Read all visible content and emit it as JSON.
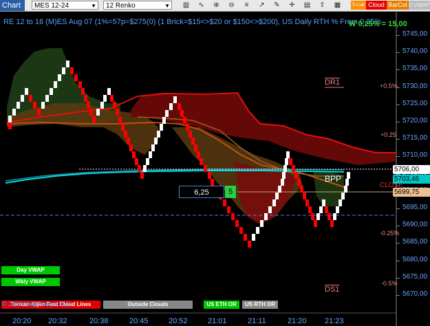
{
  "toolbar": {
    "chart_label": "Chart",
    "instrument": "MES 12-24",
    "bar_type": "12 Renko",
    "tags": [
      "T<>K",
      "Cloud",
      "BarCol",
      "0 VWAP"
    ]
  },
  "title": "RE 12 to 16 (M)ES Aug 07 (1%=57p=$275(0) (1 Brick=$15<>$20 or $150<>$200), US Daily RTH % From 0.25%",
  "pl_label": "W 0,25% = 15,00",
  "y_axis": [
    "5745,00",
    "5740,00",
    "5735,00",
    "5730,00",
    "5725,00",
    "5720,00",
    "5715,00",
    "5710,00",
    "5705,00",
    "5700,00",
    "5695,00",
    "5690,00",
    "5685,00",
    "5680,00",
    "5675,00",
    "5670,00"
  ],
  "x_axis": [
    "20:20",
    "20:32",
    "20:38",
    "20:45",
    "20:52",
    "21:01",
    "21:11",
    "21:20",
    "21:23"
  ],
  "levels": {
    "pct_up": "+0.5%",
    "pct_up2": "+0.25",
    "pct_down": "-0.25%",
    "pct_down2": "-0.5%",
    "close": "CLOSE",
    "dr1": "DR1",
    "ds1": "DS1",
    "bpp": "BPP"
  },
  "price_badges": {
    "last": "5706,00",
    "vwap": "5703,46",
    "close": "5699,75"
  },
  "tick_info": {
    "ticks": "6,25",
    "count": "5"
  },
  "buttons": {
    "day_vwap": "Day VWAP",
    "wkly_vwap": "Wkly VWAP",
    "tenkan": "Tenkan-Kijun Fast Cloud Lines",
    "outside_clouds": "Outside Clouds",
    "us_eth": "US ETH OR",
    "us_rth": "US RTH OR"
  },
  "copyright": "© 2024 NinjaTrader, LLC",
  "colors": {
    "bull_brick": "#ffffff",
    "bear_brick": "#ff0000",
    "accent": "#5aa0ff"
  }
}
